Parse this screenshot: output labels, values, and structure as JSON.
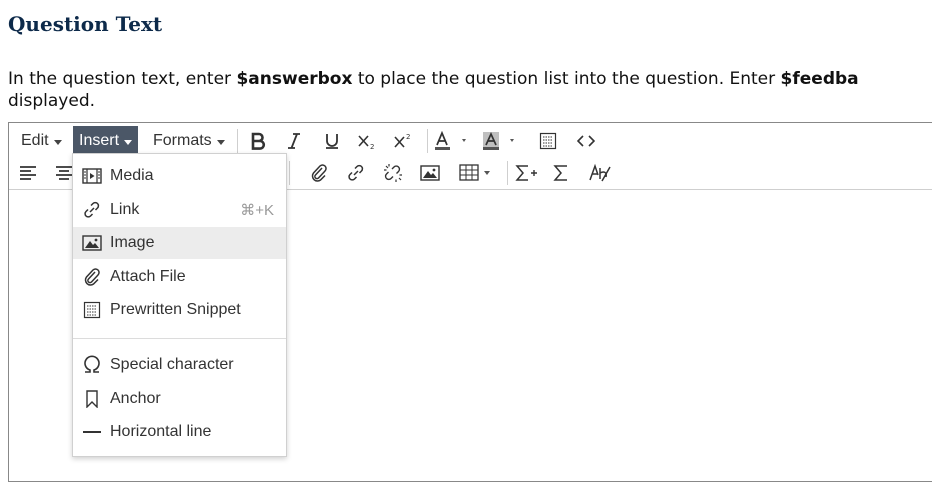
{
  "heading": "Question Text",
  "instructions": {
    "part1": "In the question text, enter ",
    "kw1": "$answerbox",
    "part2": " to place the question list into the question. Enter ",
    "kw2": "$feedba",
    "line2": "displayed."
  },
  "toolbar": {
    "edit_label": "Edit",
    "insert_label": "Insert",
    "formats_label": "Formats"
  },
  "insert_menu": {
    "items": [
      {
        "label": "Media",
        "icon": "media-icon",
        "shortcut": ""
      },
      {
        "label": "Link",
        "icon": "link-icon",
        "shortcut": "⌘+K"
      },
      {
        "label": "Image",
        "icon": "image-icon",
        "shortcut": ""
      },
      {
        "label": "Attach File",
        "icon": "paperclip-icon",
        "shortcut": ""
      },
      {
        "label": "Prewritten Snippet",
        "icon": "snippet-icon",
        "shortcut": ""
      },
      {
        "label": "Special character",
        "icon": "omega-icon",
        "shortcut": ""
      },
      {
        "label": "Anchor",
        "icon": "bookmark-icon",
        "shortcut": ""
      },
      {
        "label": "Horizontal line",
        "icon": "horizontal-line-icon",
        "shortcut": ""
      }
    ],
    "highlighted": "Image"
  },
  "colors": {
    "heading": "#0d2a4a",
    "active_menu_bg": "#4b5767",
    "highlight_bg": "#ececec"
  }
}
